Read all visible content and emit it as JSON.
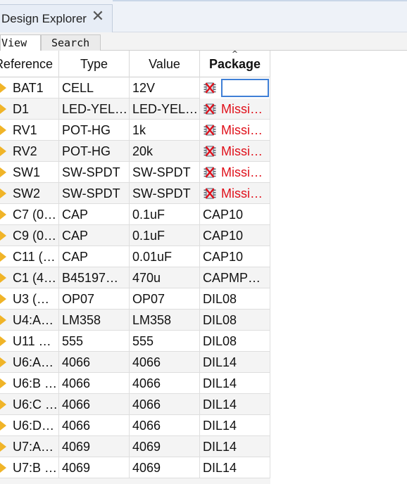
{
  "title_tab": {
    "label": "Design Explorer",
    "close_glyph": "✕"
  },
  "subtabs": {
    "view": "View",
    "search": "Search"
  },
  "columns": {
    "reference": "Reference",
    "type": "Type",
    "value": "Value",
    "package": "Package",
    "sort_indicator": "^"
  },
  "rows": [
    {
      "reference": "BAT1",
      "type": "CELL",
      "value": "12V",
      "package": "",
      "status": "editing"
    },
    {
      "reference": "D1",
      "type": "LED-YEL…",
      "value": "LED-YEL…",
      "package": "Missi…",
      "status": "missing"
    },
    {
      "reference": "RV1",
      "type": "POT-HG",
      "value": "1k",
      "package": "Missi…",
      "status": "missing"
    },
    {
      "reference": "RV2",
      "type": "POT-HG",
      "value": "20k",
      "package": "Missi…",
      "status": "missing"
    },
    {
      "reference": "SW1",
      "type": "SW-SPDT",
      "value": "SW-SPDT",
      "package": "Missi…",
      "status": "missing"
    },
    {
      "reference": "SW2",
      "type": "SW-SPDT",
      "value": "SW-SPDT",
      "package": "Missi…",
      "status": "missing"
    },
    {
      "reference": "C7 (0…",
      "type": "CAP",
      "value": "0.1uF",
      "package": "CAP10",
      "status": "ok"
    },
    {
      "reference": "C9 (0…",
      "type": "CAP",
      "value": "0.1uF",
      "package": "CAP10",
      "status": "ok"
    },
    {
      "reference": "C11 (…",
      "type": "CAP",
      "value": "0.01uF",
      "package": "CAP10",
      "status": "ok"
    },
    {
      "reference": "C1 (4…",
      "type": "B45197…",
      "value": "470u",
      "package": "CAPMP…",
      "status": "ok"
    },
    {
      "reference": "U3 (…",
      "type": "OP07",
      "value": "OP07",
      "package": "DIL08",
      "status": "ok"
    },
    {
      "reference": "U4:A…",
      "type": "LM358",
      "value": "LM358",
      "package": "DIL08",
      "status": "ok"
    },
    {
      "reference": "U11 …",
      "type": "555",
      "value": "555",
      "package": "DIL08",
      "status": "ok"
    },
    {
      "reference": "U6:A…",
      "type": "4066",
      "value": "4066",
      "package": "DIL14",
      "status": "ok"
    },
    {
      "reference": "U6:B …",
      "type": "4066",
      "value": "4066",
      "package": "DIL14",
      "status": "ok"
    },
    {
      "reference": "U6:C …",
      "type": "4066",
      "value": "4066",
      "package": "DIL14",
      "status": "ok"
    },
    {
      "reference": "U6:D…",
      "type": "4066",
      "value": "4066",
      "package": "DIL14",
      "status": "ok"
    },
    {
      "reference": "U7:A…",
      "type": "4069",
      "value": "4069",
      "package": "DIL14",
      "status": "ok"
    },
    {
      "reference": "U7:B …",
      "type": "4069",
      "value": "4069",
      "package": "DIL14",
      "status": "ok"
    }
  ],
  "icons": {
    "row_marker": "expand-arrow-icon",
    "package_missing": "chip-missing-icon",
    "package_edit": "chip-icon"
  },
  "colors": {
    "missing_text": "#e0101a",
    "row_marker": "#f0b428",
    "edit_border": "#3f7fd6"
  }
}
